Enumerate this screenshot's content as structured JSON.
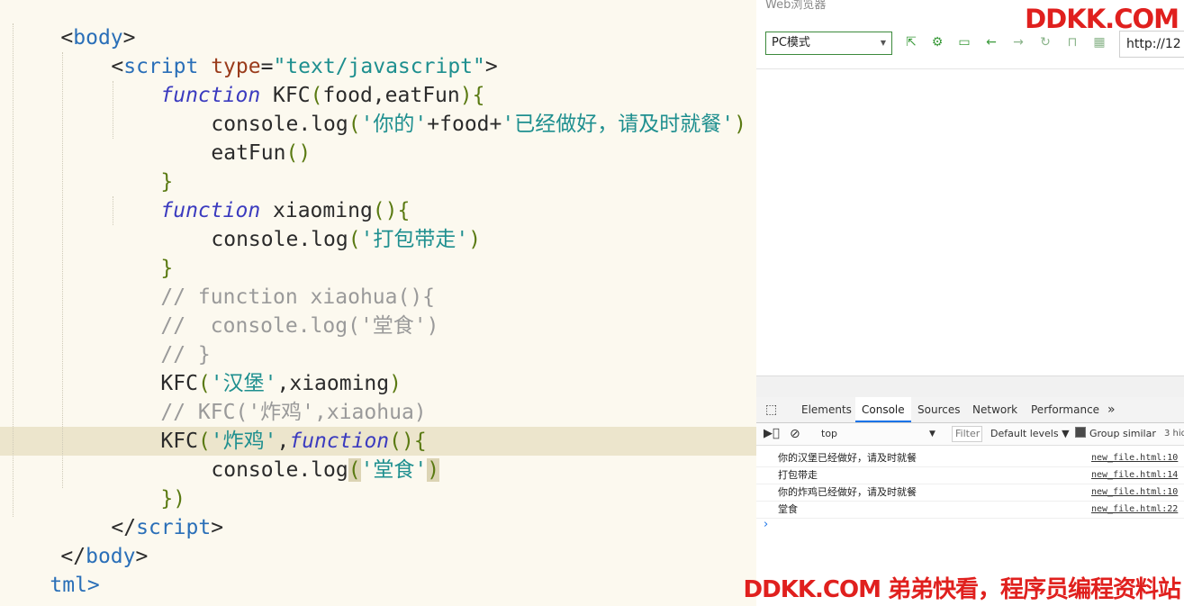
{
  "editor": {
    "lines": {
      "l1": {
        "lt": "<",
        "tag": "body",
        "gt": ">"
      },
      "l2": {
        "lt": "<",
        "tag": "script",
        "sp": " ",
        "attr": "type",
        "eq": "=",
        "val": "\"text/javascript\"",
        "gt": ">"
      },
      "l3": {
        "kw": "function",
        "name": " KFC",
        "open": "(",
        "args": "food,eatFun",
        "close": ")",
        "brace": "{"
      },
      "l4": {
        "fn": "console.log",
        "open": "(",
        "s1": "'你的'",
        "op1": "+food+",
        "s2": "'已经做好，请及时就餐'",
        "close": ")"
      },
      "l5": {
        "fn": "eatFun",
        "open": "(",
        "close": ")"
      },
      "l6": {
        "brace": "}"
      },
      "l7": {
        "kw": "function",
        "name": " xiaoming",
        "open": "(",
        "close": ")",
        "brace": "{"
      },
      "l8": {
        "fn": "console.log",
        "open": "(",
        "s1": "'打包带走'",
        "close": ")"
      },
      "l9": {
        "brace": "}"
      },
      "l10": {
        "text": "// function xiaohua(){"
      },
      "l11": {
        "text": "//  console.log('堂食')"
      },
      "l12": {
        "text": "// }"
      },
      "l13": {
        "fn": "KFC",
        "open": "(",
        "s1": "'汉堡'",
        "rest": ",xiaoming",
        "close": ")"
      },
      "l14": {
        "text": "// KFC('炸鸡',xiaohua)"
      },
      "l15": {
        "fn": "KFC",
        "open": "(",
        "s1": "'炸鸡'",
        "comma": ",",
        "kw": "function",
        "open2": "(",
        "close2": ")",
        "brace": "{"
      },
      "l16": {
        "fn": "console.log",
        "open": "(",
        "s1": "'堂食'",
        "close": ")"
      },
      "l17": {
        "brace": "}",
        "close": ")"
      },
      "l18": {
        "lt": "</",
        "tag": "script",
        "gt": ">"
      },
      "l19": {
        "lt": "</",
        "tag": "body",
        "gt": ">"
      },
      "l20": {
        "text": "tml>"
      }
    }
  },
  "browser": {
    "title": "Web浏览器",
    "mode_select": "PC模式",
    "url": "http://12",
    "toolbar_icons": [
      "open-external-icon",
      "settings-icon",
      "console-icon",
      "back-arrow-icon",
      "forward-arrow-icon",
      "refresh-icon",
      "lock-icon",
      "qrcode-icon"
    ]
  },
  "devtools": {
    "tabs": [
      "Elements",
      "Console",
      "Sources",
      "Network",
      "Performance"
    ],
    "more": "»",
    "context": "top",
    "filter_placeholder": "Filter",
    "levels": "Default levels ▼",
    "group_similar": "Group similar",
    "hidden": "3 hid",
    "logs": [
      {
        "msg": "你的汉堡已经做好，请及时就餐",
        "src": "new_file.html:10"
      },
      {
        "msg": "打包带走",
        "src": "new_file.html:14"
      },
      {
        "msg": "你的炸鸡已经做好，请及时就餐",
        "src": "new_file.html:10"
      },
      {
        "msg": "堂食",
        "src": "new_file.html:22"
      }
    ],
    "prompt": "›"
  },
  "watermark": {
    "top": "DDKK.COM",
    "bottom": "DDKK.COM 弟弟快看，程序员编程资料站"
  },
  "colors": {
    "accent": "#e0201e",
    "tag": "#2a6fb8",
    "string": "#1e8f8f",
    "keyword": "#3b3bbf",
    "comment": "#9a9a9a"
  }
}
